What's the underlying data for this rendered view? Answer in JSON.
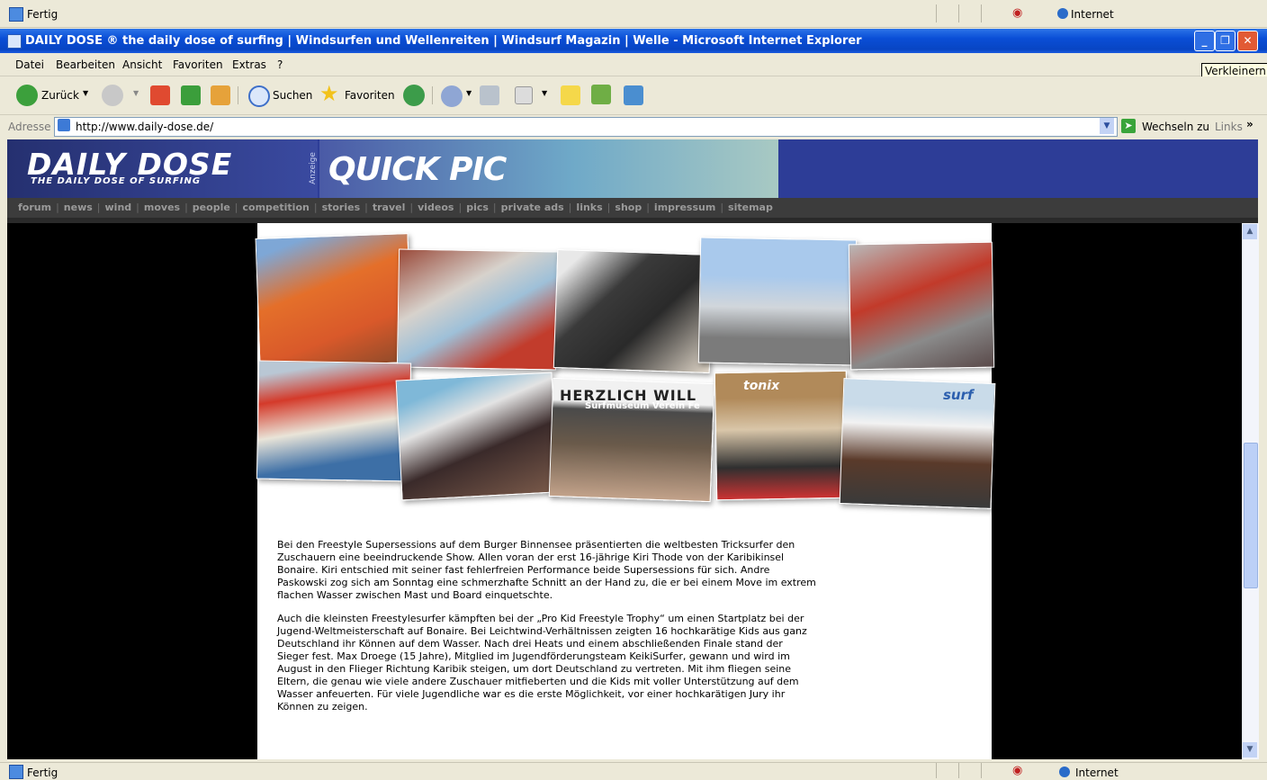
{
  "status_top": {
    "text": "Fertig",
    "zone": "Internet"
  },
  "window": {
    "title": "DAILY DOSE ® the daily dose of surfing | Windsurfen und Wellenreiten | Windsurf Magazin | Welle - Microsoft Internet Explorer",
    "tooltip": "Verkleinern"
  },
  "menu": [
    "Datei",
    "Bearbeiten",
    "Ansicht",
    "Favoriten",
    "Extras",
    "?"
  ],
  "toolbar": {
    "back": "Zurück",
    "search": "Suchen",
    "favorites": "Favoriten"
  },
  "address": {
    "label": "Adresse",
    "url": "http://www.daily-dose.de/",
    "go": "Wechseln zu",
    "links": "Links",
    "links_chevron": "»"
  },
  "site": {
    "logo": "DAILY DOSE",
    "tagline": "THE DAILY DOSE OF SURFING",
    "ad_label": "Anzeige",
    "banner": "QUICK PIC",
    "nav": [
      "forum",
      "news",
      "wind",
      "moves",
      "people",
      "competition",
      "stories",
      "travel",
      "videos",
      "pics",
      "private ads",
      "links",
      "shop",
      "impressum",
      "sitemap"
    ]
  },
  "article": {
    "p1": "Bei den Freestyle Supersessions auf dem Burger Binnensee präsentierten die weltbesten Tricksurfer den Zuschauern eine beeindruckende Show. Allen voran der erst 16-jährige Kiri Thode von der Karibikinsel Bonaire. Kiri entschied mit seiner fast fehlerfreien Performance beide Supersessions für sich. Andre Paskowski zog sich am Sonntag eine schmerzhafte Schnitt an der Hand zu, die er bei einem Move im extrem flachen Wasser zwischen Mast und Board einquetschte.",
    "p2": "Auch die kleinsten Freestylesurfer kämpften bei der „Pro Kid Freestyle Trophy“ um einen Startplatz bei der Jugend-Weltmeisterschaft auf Bonaire. Bei Leichtwind-Verhältnissen zeigten 16 hochkarätige Kids aus ganz Deutschland ihr Können auf dem Wasser. Nach drei Heats und einem abschließenden Finale stand der Sieger fest. Max Droege (15 Jahre), Mitglied im Jugendförderungsteam KeikiSurfer, gewann und wird im August in den Flieger Richtung Karibik steigen, um dort Deutschland zu vertreten. Mit ihm fliegen seine Eltern, die genau wie viele andere Zuschauer mitfieberten und die Kids mit voller Unterstützung auf dem Wasser anfeuerten. Für viele Jugendliche war es die erste Möglichkeit, vor einer hochkarätigen Jury ihr Können zu zeigen."
  },
  "collage_labels": {
    "banner_herzlich": "HERZLICH WILL",
    "banner_surfmuseum": "Surfmuseum Verein Fe",
    "banner_tonix": "tonix",
    "banner_surf": "surf"
  },
  "status_bottom": {
    "text": "Fertig",
    "zone": "Internet"
  }
}
